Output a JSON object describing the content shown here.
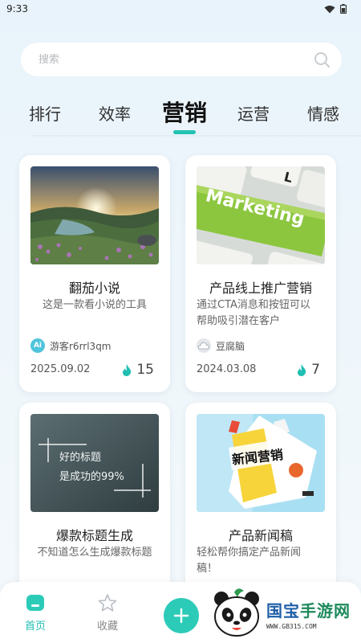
{
  "status_bar": {
    "time": "9:33"
  },
  "search": {
    "placeholder": "搜索"
  },
  "tabs": [
    {
      "label": "排行"
    },
    {
      "label": "效率"
    },
    {
      "label": "营销",
      "active": true
    },
    {
      "label": "运营"
    },
    {
      "label": "情感"
    }
  ],
  "cards": [
    {
      "title": "翻茄小说",
      "desc": "这是一款看小说的工具",
      "author": "游客r6rrl3qm",
      "avatar_text": "Ai",
      "date": "2025.09.02",
      "count": "15"
    },
    {
      "title": "产品线上推广营销",
      "desc_lines": [
        "通过CTA消息和按钮可以",
        "帮助吸引潜在客户"
      ],
      "author": "豆腐脑",
      "date": "2024.03.08",
      "count": "7",
      "image_text": "Marketing"
    },
    {
      "title": "爆款标题生成",
      "desc": "不知道怎么生成爆款标题",
      "image_lines": [
        "好的标题",
        "是成功的99%"
      ]
    },
    {
      "title": "产品新闻稿",
      "desc_lines": [
        "轻松帮你搞定产品新闻",
        "稿！"
      ],
      "image_text": "新闻营销"
    }
  ],
  "bottom_nav": {
    "home": "首页",
    "favorites": "收藏"
  },
  "watermark": {
    "main_a": "国宝",
    "main_b": "手游网",
    "sub": "WWW.GB315.COM"
  },
  "colors": {
    "accent": "#23c2b4",
    "fab": "#2ccbb8",
    "flame": "#1fbfb1"
  }
}
